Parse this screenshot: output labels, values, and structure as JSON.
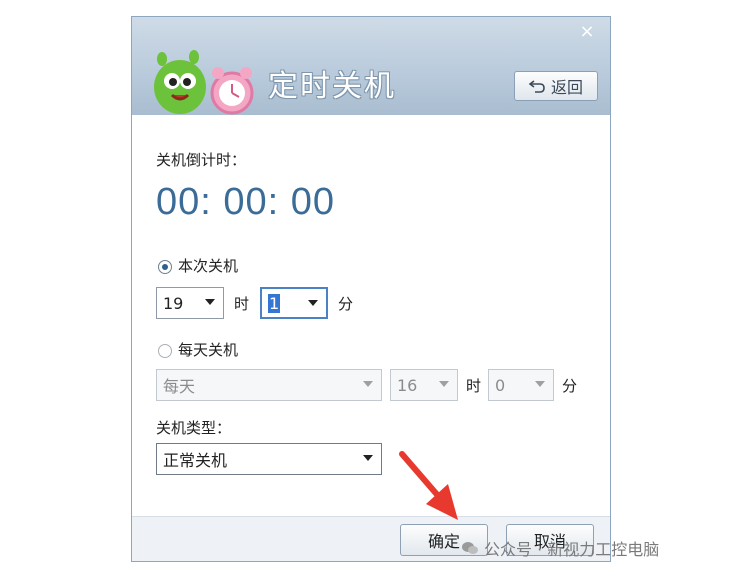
{
  "window": {
    "title": "定时关机",
    "close_glyph": "×",
    "back_label": "返回",
    "back_icon": "return-arrow-icon"
  },
  "countdown": {
    "label": "关机倒计时：",
    "value": "00: 00: 00"
  },
  "once": {
    "label": "本次关机",
    "selected": true,
    "hour": "19",
    "hour_unit": "时",
    "minute": "1",
    "minute_unit": "分"
  },
  "daily": {
    "label": "每天关机",
    "selected": false,
    "day": "每天",
    "hour": "16",
    "hour_unit": "时",
    "minute": "0",
    "minute_unit": "分"
  },
  "type": {
    "label": "关机类型：",
    "value": "正常关机"
  },
  "footer": {
    "ok_label": "确定",
    "cancel_label": "取消"
  },
  "watermark": {
    "text": "公众号 · 新视力工控电脑"
  },
  "colors": {
    "timer": "#3a6c97",
    "header": "#b8cadb",
    "arrow": "#e8392f",
    "mascot": "#6cc23a"
  }
}
